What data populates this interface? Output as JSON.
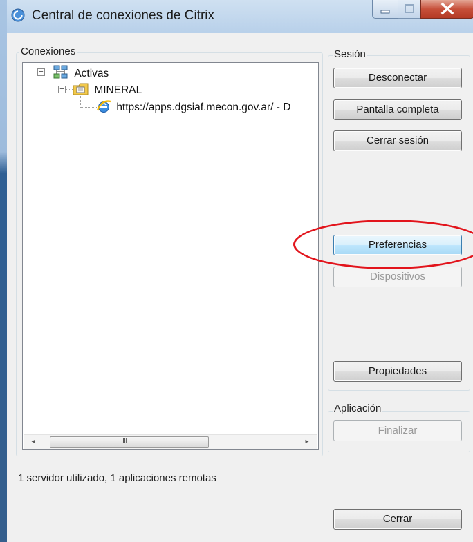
{
  "window": {
    "title": "Central de conexiones de Citrix",
    "title_icon": "citrix-icon"
  },
  "connections": {
    "group_label": "Conexiones",
    "tree": {
      "root": {
        "label": "Activas",
        "icon": "network-computers-icon",
        "expanded": true
      },
      "server": {
        "label": "MINERAL",
        "icon": "folder-server-icon",
        "expanded": true
      },
      "app": {
        "label": "https://apps.dgsiaf.mecon.gov.ar/ - D",
        "icon": "internet-explorer-icon"
      }
    },
    "scrollbar_grip": "III"
  },
  "session": {
    "group_label": "Sesión",
    "disconnect": "Desconectar",
    "fullscreen": "Pantalla completa",
    "logoff": "Cerrar sesión",
    "preferences": "Preferencias",
    "devices": "Dispositivos",
    "properties": "Propiedades"
  },
  "application": {
    "group_label": "Aplicación",
    "terminate": "Finalizar"
  },
  "status_text": "1 servidor utilizado, 1 aplicaciones remotas",
  "close_button": "Cerrar",
  "colors": {
    "highlight_annotation": "#e2141c",
    "title_bar": "#b9d1ea",
    "dialog_background": "#f0f0f0"
  }
}
